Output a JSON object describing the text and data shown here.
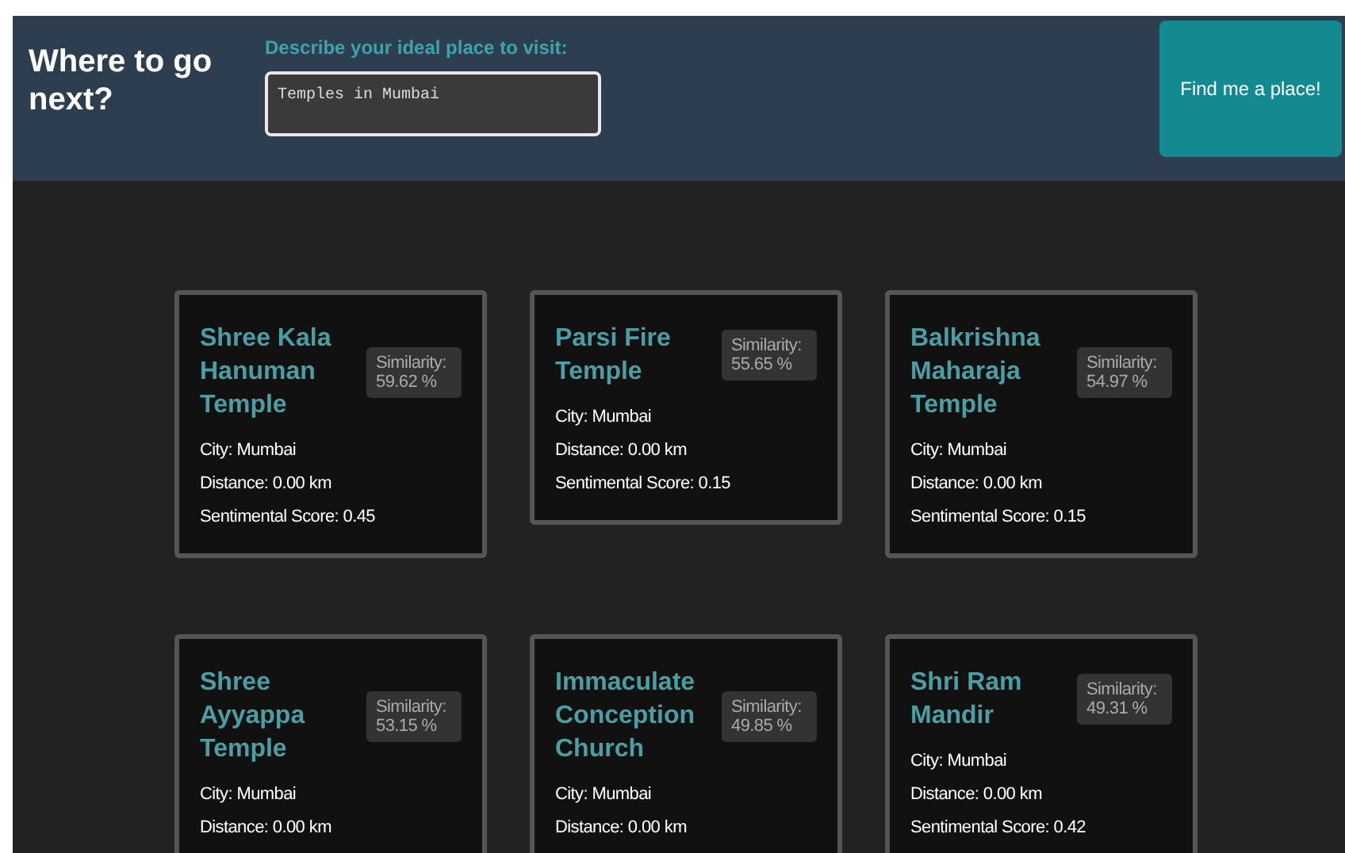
{
  "header": {
    "title": "Where to go next?",
    "prompt_label": "Describe your ideal place to visit:",
    "query": "Temples in Mumbai",
    "button": "Find me a place!"
  },
  "places": [
    {
      "name": "Shree Kala Hanuman Temple",
      "similarity": "Similarity: 59.62 %",
      "details": [
        "City: Mumbai",
        "Distance: 0.00 km",
        "Sentimental Score: 0.45"
      ]
    },
    {
      "name": "Parsi Fire Temple",
      "similarity": "Similarity: 55.65 %",
      "details": [
        "City: Mumbai",
        "Distance: 0.00 km",
        "Sentimental Score: 0.15"
      ]
    },
    {
      "name": "Balkrishna Maharaja Temple",
      "similarity": "Similarity: 54.97 %",
      "details": [
        "City: Mumbai",
        "Distance: 0.00 km",
        "Sentimental Score: 0.15"
      ]
    },
    {
      "name": "Shree Ayyappa Temple",
      "similarity": "Similarity: 53.15 %",
      "details": [
        "City: Mumbai",
        "Distance: 0.00 km"
      ]
    },
    {
      "name": "Immaculate Conception Church",
      "similarity": "Similarity: 49.85 %",
      "details": [
        "City: Mumbai",
        "Distance: 0.00 km"
      ]
    },
    {
      "name": "Shri Ram Mandir",
      "similarity": "Similarity: 49.31 %",
      "details": [
        "City: Mumbai",
        "Distance: 0.00 km",
        "Sentimental Score: 0.42"
      ]
    }
  ]
}
